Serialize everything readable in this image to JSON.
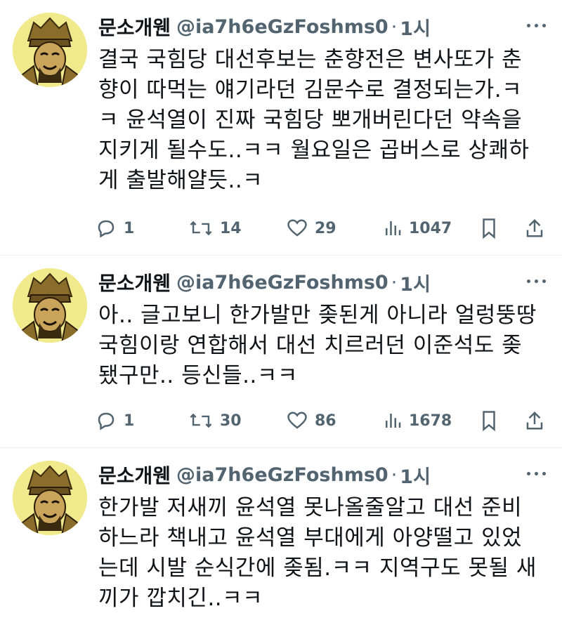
{
  "tweets": [
    {
      "name": "문소개웬",
      "handle": "@ia7h6eGzFoshms0",
      "sep": "·",
      "time": "1시",
      "lines": [
        "결국 국힘당 대선후보는 춘향전은 변사또가 춘",
        "향이 따먹는 얘기라던 김문수로 결정되는가.ㅋ",
        "ㅋ 윤석열이 진짜 국힘당 뽀개버린다던 약속을",
        "지키게 될수도..ㅋㅋ 월요일은 곱버스로 상쾌하",
        "게 출발해얄듯..ㅋ"
      ],
      "replies": "1",
      "retweets": "14",
      "likes": "29",
      "views": "1047"
    },
    {
      "name": "문소개웬",
      "handle": "@ia7h6eGzFoshms0",
      "sep": "·",
      "time": "1시",
      "lines": [
        "아.. 글고보니 한가발만 좆된게 아니라 얼렁뚱땅",
        "국힘이랑 연합해서 대선 치르러던 이준석도 좆",
        "됐구만.. 등신들..ㅋㅋ"
      ],
      "replies": "1",
      "retweets": "30",
      "likes": "86",
      "views": "1678"
    },
    {
      "name": "문소개웬",
      "handle": "@ia7h6eGzFoshms0",
      "sep": "·",
      "time": "1시",
      "lines": [
        "한가발 저새끼 윤석열 못나올줄알고 대선 준비",
        "하느라 책내고 윤석열 부대에게 아양떨고 있었",
        "는데 시발 순식간에 좆됨.ㅋㅋ 지역구도 못될 새",
        "끼가 깝치긴..ㅋㅋ"
      ]
    }
  ],
  "icons": {
    "reply": "reply-icon",
    "retweet": "retweet-icon",
    "like": "heart-icon",
    "views": "views-icon",
    "bookmark": "bookmark-icon",
    "share": "share-icon",
    "more": "more-icon"
  },
  "colors": {
    "secondary_text": "#536471",
    "avatar_bg": "#f0ea8c",
    "divider": "#eff3f4"
  }
}
